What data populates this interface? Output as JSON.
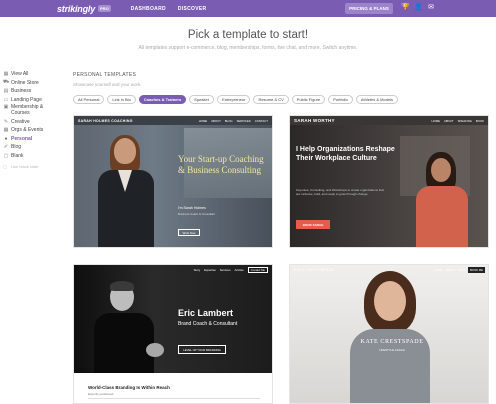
{
  "topbar": {
    "logo": "strikingly",
    "badge": "PRO",
    "nav": [
      "DASHBOARD",
      "DISCOVER"
    ],
    "pricing": "PRICING & PLANS",
    "icons": [
      "trophy-icon",
      "user-icon",
      "mail-icon"
    ]
  },
  "hero": {
    "title": "Pick a template to start!",
    "subtitle": "All templates support e-commerce, blog, memberships, forms, live chat, and more. Switch anytime."
  },
  "sidebar": {
    "items": [
      {
        "label": "View All",
        "icon": "grid-icon"
      },
      {
        "label": "Online Store",
        "icon": "cart-icon"
      },
      {
        "label": "Business",
        "icon": "briefcase-icon"
      },
      {
        "label": "Landing Page",
        "icon": "page-icon"
      },
      {
        "label": "Membership & Courses",
        "icon": "member-icon"
      },
      {
        "label": "Creative",
        "icon": "brush-icon"
      },
      {
        "label": "Orgs & Events",
        "icon": "calendar-icon"
      },
      {
        "label": "Personal",
        "icon": "person-icon"
      },
      {
        "label": "Blog",
        "icon": "pen-icon"
      },
      {
        "label": "Blank",
        "icon": "blank-icon"
      }
    ],
    "footer": "Use blank slate"
  },
  "section": {
    "title": "PERSONAL TEMPLATES",
    "subtitle": "Showcase yourself and your work."
  },
  "chips": [
    "All Personal",
    "Link in Bio",
    "Coaches & Trainers",
    "Speaker",
    "Entrepreneur",
    "Resume & CV",
    "Public Figure",
    "Portfolio",
    "Athletes & Models"
  ],
  "cards": {
    "c1": {
      "brand": "SARAH HOLMES COACHING",
      "links": [
        "HOME",
        "ABOUT",
        "BLOG",
        "SERVICES",
        "CONTACT"
      ],
      "title": "Your Start-up Coaching & Business Consulting",
      "name": "I'm Sarah Holmes",
      "role": "Business Coach & Consultant",
      "button": "Work Now"
    },
    "c2": {
      "brand": "SARAH WORTHY",
      "links": [
        "HOME",
        "ABOUT",
        "SPEAKING",
        "BOOK"
      ],
      "title": "I Help Organizations Reshape Their Workplace Culture",
      "sub": "Keynotes, Consulting, and Workshops to create organizations that are inclusive, bold, and ready to grow through change.",
      "button": "BOOK SARAH"
    },
    "c3": {
      "links": [
        "Story",
        "Expertise",
        "Services",
        "Articles",
        "Contact Me"
      ],
      "name": "Eric Lambert",
      "role": "Brand Coach & Consultant",
      "button": "LEVEL UP YOUR BRANDING",
      "lower_title": "World-Class Branding Is Within Reach",
      "lower_sub": "Expertly positioned"
    },
    "c4": {
      "brand": "KATE CRESTSPADE",
      "links": [
        "HOME",
        "ABOUT",
        "BLOG"
      ],
      "button": "BOOK ME",
      "name": "KATE CRESTSPADE",
      "role": "LIFESTYLE COACH"
    }
  }
}
